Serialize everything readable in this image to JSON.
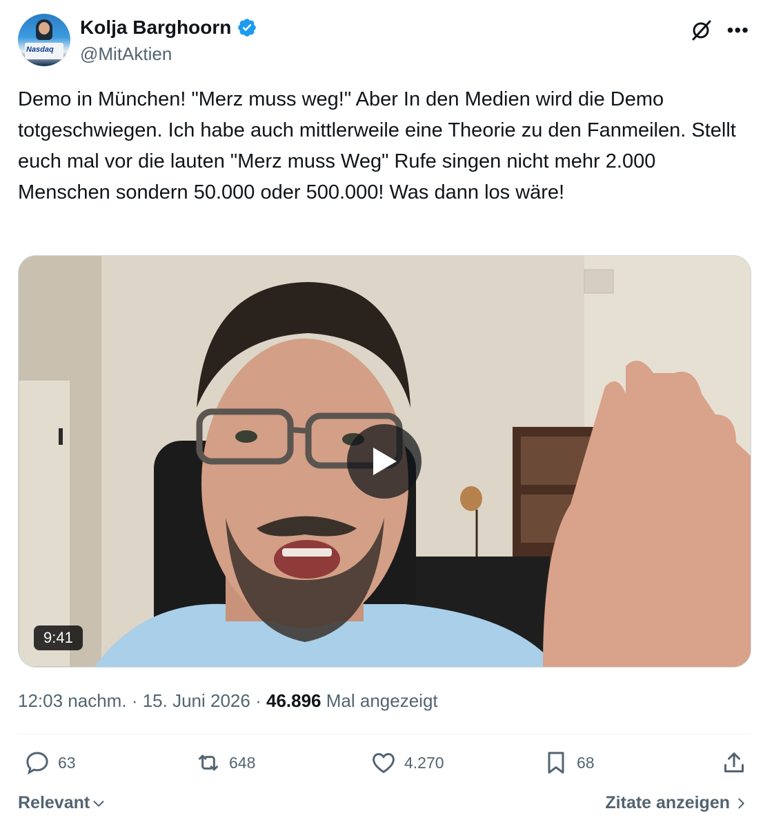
{
  "author": {
    "display_name": "Kolja Barghoorn",
    "handle": "@MitAktien",
    "verified": true,
    "avatar_text": "Nasdaq"
  },
  "tweet": {
    "text": "Demo in München! \"Merz muss weg!\" Aber In den Medien wird die Demo totgeschwiegen. Ich habe auch mittlerweile eine Theorie zu den Fanmeilen. Stellt euch mal vor die lauten \"Merz muss Weg\" Rufe singen nicht mehr 2.000 Menschen sondern 50.000 oder 500.000! Was dann los wäre!"
  },
  "media": {
    "duration": "9:41"
  },
  "meta": {
    "time": "12:03 nachm.",
    "separator": "·",
    "date": "15. Juni 2026",
    "views_count": "46.896",
    "views_label": "Mal angezeigt"
  },
  "actions": {
    "replies": "63",
    "reposts": "648",
    "likes": "4.270",
    "bookmarks": "68"
  },
  "footer": {
    "sort_label": "Relevant",
    "quotes_label": "Zitate anzeigen"
  },
  "colors": {
    "text_primary": "#0f1419",
    "text_secondary": "#536471",
    "verified_blue": "#1d9bf0",
    "divider": "#eff3f4"
  }
}
